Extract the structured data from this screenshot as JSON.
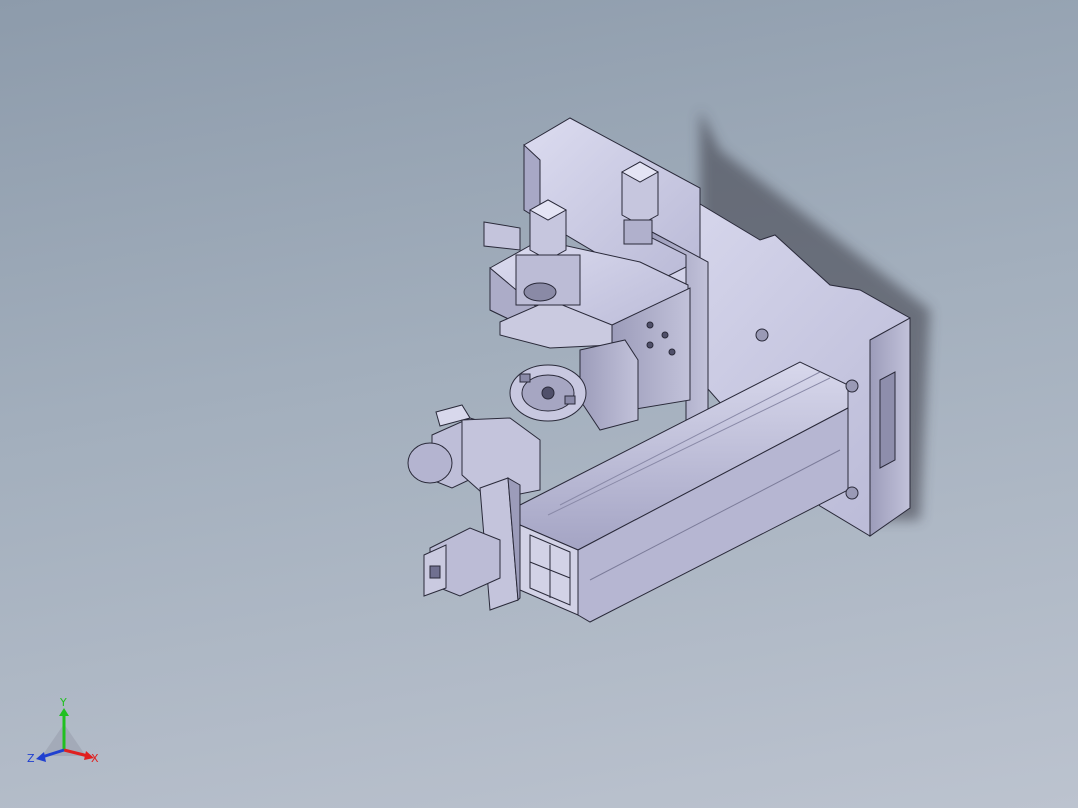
{
  "viewport": {
    "background_top": "#8d9bab",
    "background_bottom": "#bcc3cf",
    "part_color": "#c8c8e0"
  },
  "triad": {
    "x_label": "X",
    "y_label": "Y",
    "z_label": "Z",
    "x_color": "#e02020",
    "y_color": "#20c020",
    "z_color": "#2040d0"
  }
}
